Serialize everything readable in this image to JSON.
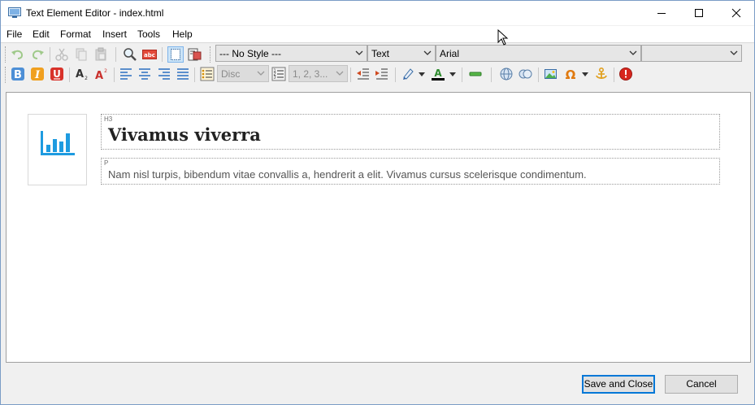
{
  "window": {
    "title": "Text Element Editor - index.html"
  },
  "menu": [
    "File",
    "Edit",
    "Format",
    "Insert",
    "Tools",
    "Help"
  ],
  "toolbar": {
    "style_select": "--- No Style ---",
    "type_select": "Text",
    "font_select": "Arial",
    "size_select": "",
    "bullet_select": "Disc",
    "number_select": "1, 2, 3..."
  },
  "content": {
    "heading_tag": "H3",
    "heading": "Vivamus viverra",
    "paragraph_tag": "P",
    "paragraph": "Nam nisl turpis, bibendum vitae convallis a, hendrerit a elit. Vivamus cursus scelerisque condimentum."
  },
  "buttons": {
    "save": "Save and Close",
    "cancel": "Cancel"
  },
  "icons": {
    "chart_icon_color": "#1e9be0"
  }
}
